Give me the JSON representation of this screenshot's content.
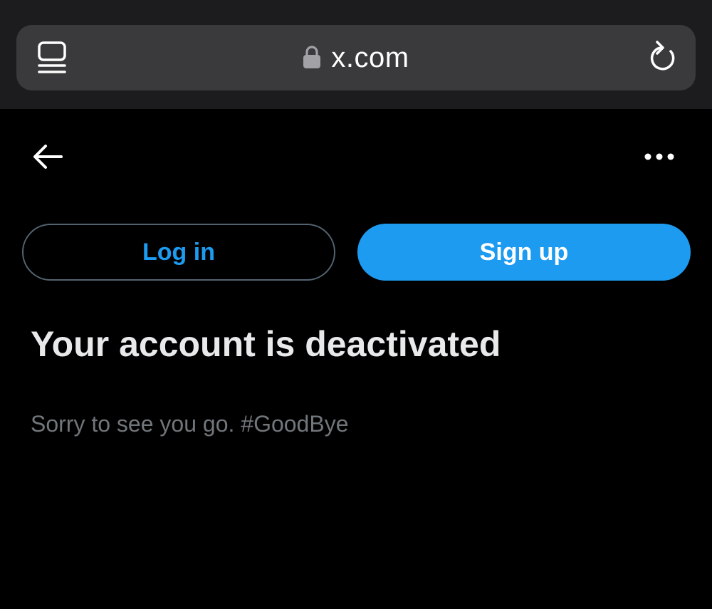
{
  "browser": {
    "url": "x.com",
    "icons": {
      "tabs": "tabs-icon",
      "lock": "lock-icon",
      "reload": "reload-icon"
    }
  },
  "header": {
    "icons": {
      "back": "back-arrow-icon",
      "more": "more-options-icon"
    }
  },
  "auth": {
    "login_label": "Log in",
    "signup_label": "Sign up"
  },
  "main": {
    "title": "Your account is deactivated",
    "message": "Sorry to see you go. #GoodBye"
  },
  "colors": {
    "accent": "#1d9bf0",
    "background": "#000000",
    "heading_text": "#e7e9ea",
    "secondary_text": "#71767b",
    "chrome_bg": "#1c1c1e",
    "address_bar_bg": "#3a3a3c"
  }
}
